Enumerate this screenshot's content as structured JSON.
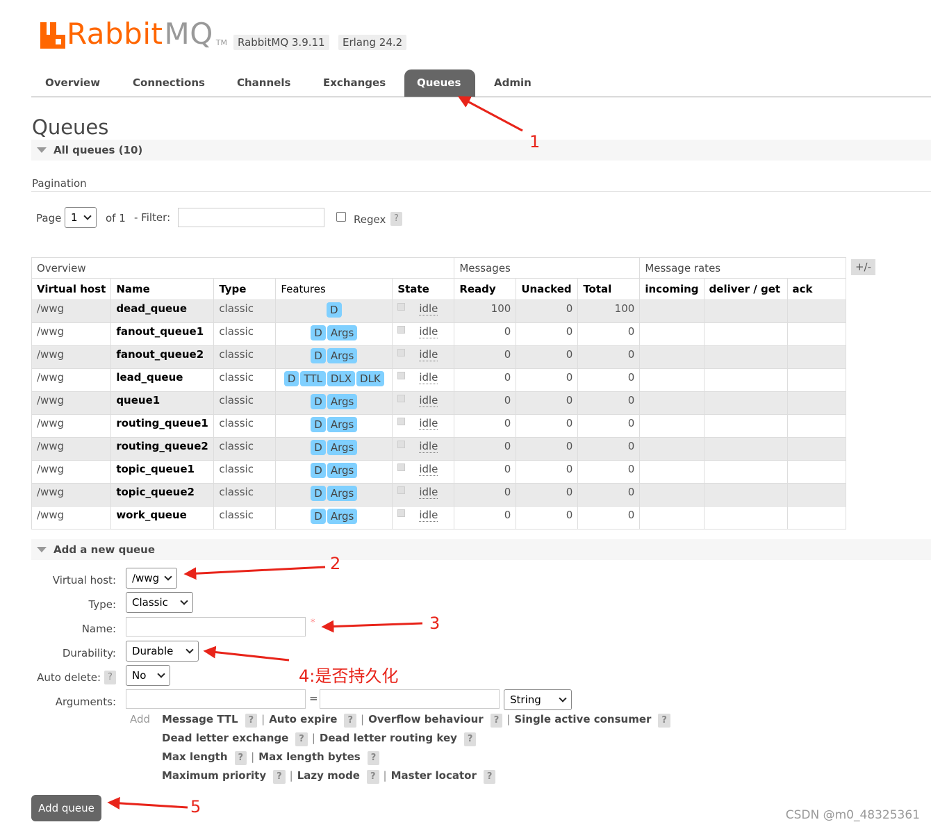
{
  "header": {
    "logo_orange": "Rabbit",
    "logo_gray": "MQ",
    "logo_tm": "TM",
    "rabbit_version": "RabbitMQ 3.9.11",
    "erlang_version": "Erlang 24.2"
  },
  "tabs": [
    {
      "label": "Overview"
    },
    {
      "label": "Connections"
    },
    {
      "label": "Channels"
    },
    {
      "label": "Exchanges"
    },
    {
      "label": "Queues",
      "active": true
    },
    {
      "label": "Admin"
    }
  ],
  "page": {
    "title": "Queues",
    "all_queues": "All queues (10)",
    "pagination_label": "Pagination",
    "page_label": "Page",
    "page_value": "1",
    "of_label": "of 1",
    "filter_label": "- Filter:",
    "filter_value": "",
    "regex_label": "Regex",
    "help": "?"
  },
  "table": {
    "group_headers": [
      "Overview",
      "Messages",
      "Message rates"
    ],
    "plus_minus": "+/-",
    "columns": [
      "Virtual host",
      "Name",
      "Type",
      "Features",
      "State",
      "Ready",
      "Unacked",
      "Total",
      "incoming",
      "deliver / get",
      "ack"
    ],
    "rows": [
      {
        "vhost": "/wwg",
        "name": "dead_queue",
        "type": "classic",
        "features": [
          "D"
        ],
        "state": "idle",
        "ready": "100",
        "unacked": "0",
        "total": "100"
      },
      {
        "vhost": "/wwg",
        "name": "fanout_queue1",
        "type": "classic",
        "features": [
          "D",
          "Args"
        ],
        "state": "idle",
        "ready": "0",
        "unacked": "0",
        "total": "0"
      },
      {
        "vhost": "/wwg",
        "name": "fanout_queue2",
        "type": "classic",
        "features": [
          "D",
          "Args"
        ],
        "state": "idle",
        "ready": "0",
        "unacked": "0",
        "total": "0"
      },
      {
        "vhost": "/wwg",
        "name": "lead_queue",
        "type": "classic",
        "features": [
          "D",
          "TTL",
          "DLX",
          "DLK"
        ],
        "state": "idle",
        "ready": "0",
        "unacked": "0",
        "total": "0"
      },
      {
        "vhost": "/wwg",
        "name": "queue1",
        "type": "classic",
        "features": [
          "D",
          "Args"
        ],
        "state": "idle",
        "ready": "0",
        "unacked": "0",
        "total": "0"
      },
      {
        "vhost": "/wwg",
        "name": "routing_queue1",
        "type": "classic",
        "features": [
          "D",
          "Args"
        ],
        "state": "idle",
        "ready": "0",
        "unacked": "0",
        "total": "0"
      },
      {
        "vhost": "/wwg",
        "name": "routing_queue2",
        "type": "classic",
        "features": [
          "D",
          "Args"
        ],
        "state": "idle",
        "ready": "0",
        "unacked": "0",
        "total": "0"
      },
      {
        "vhost": "/wwg",
        "name": "topic_queue1",
        "type": "classic",
        "features": [
          "D",
          "Args"
        ],
        "state": "idle",
        "ready": "0",
        "unacked": "0",
        "total": "0"
      },
      {
        "vhost": "/wwg",
        "name": "topic_queue2",
        "type": "classic",
        "features": [
          "D",
          "Args"
        ],
        "state": "idle",
        "ready": "0",
        "unacked": "0",
        "total": "0"
      },
      {
        "vhost": "/wwg",
        "name": "work_queue",
        "type": "classic",
        "features": [
          "D",
          "Args"
        ],
        "state": "idle",
        "ready": "0",
        "unacked": "0",
        "total": "0"
      }
    ]
  },
  "add_queue": {
    "section_title": "Add a new queue",
    "vhost_label": "Virtual host:",
    "vhost_value": "/wwg",
    "type_label": "Type:",
    "type_value": "Classic",
    "name_label": "Name:",
    "name_value": "",
    "required_mark": "*",
    "durability_label": "Durability:",
    "durability_value": "Durable",
    "autodelete_label": "Auto delete:",
    "autodelete_value": "No",
    "arguments_label": "Arguments:",
    "args_equals": "=",
    "args_type_value": "String",
    "add_label": "Add",
    "links": [
      [
        "Message TTL",
        "Auto expire",
        "Overflow behaviour",
        "Single active consumer"
      ],
      [
        "Dead letter exchange",
        "Dead letter routing key"
      ],
      [
        "Max length",
        "Max length bytes"
      ],
      [
        "Maximum priority",
        "Lazy mode",
        "Master locator"
      ]
    ],
    "separator": "|",
    "button_label": "Add queue"
  },
  "annotations": [
    "1",
    "2",
    "3",
    "4:是否持久化",
    "5"
  ],
  "watermark": "CSDN @m0_48325361",
  "colors": {
    "brand": "#ff6600",
    "active_tab": "#666666",
    "chip": "#80d0ff",
    "annotation": "#e8241a"
  }
}
